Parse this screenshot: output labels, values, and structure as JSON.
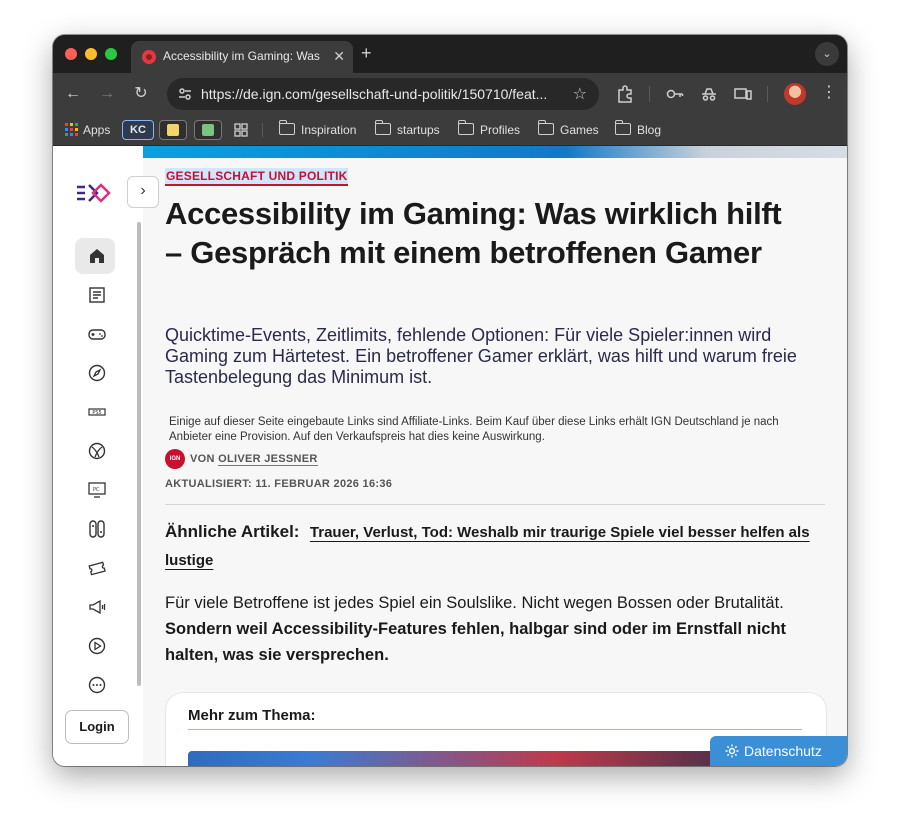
{
  "browser": {
    "tab_title": "Accessibility im Gaming: Was wirklich hilft – Gespräch mit einem betroffenen Gamer",
    "tab_close": "✕",
    "new_tab": "+",
    "url": "https://de.ign.com/gesellschaft-und-politik/150710/feat...",
    "bookmarks": {
      "apps": "Apps",
      "kc": "KC",
      "folders": [
        "Inspiration",
        "startups",
        "Profiles",
        "Games",
        "Blog"
      ]
    }
  },
  "sidebar": {
    "login": "Login",
    "icons": [
      "home-icon",
      "news-icon",
      "gamepad-icon",
      "compass-icon",
      "ps5-icon",
      "xbox-icon",
      "pc-icon",
      "switch-icon",
      "ticket-icon",
      "megaphone-icon",
      "play-icon",
      "more-icon"
    ]
  },
  "article": {
    "kicker": "GESELLSCHAFT UND POLITIK",
    "headline": "Accessibility im Gaming: Was wirklich hilft – Gespräch mit einem betroffenen Gamer",
    "deck": "Quicktime-Events, Zeitlimits, fehlende Optionen: Für viele Spieler:innen wird Gaming zum Härtetest. Ein betroffener Gamer erklärt, was hilft und warum freie Tastenbelegung das Minimum ist.",
    "disclaimer": "Einige auf dieser Seite eingebaute Links sind Affiliate-Links. Beim Kauf über diese Links erhält IGN Deutschland je nach Anbieter eine Provision. Auf den Verkaufspreis hat dies keine Auswirkung.",
    "author_logo": "IGN",
    "byline_prefix": "VON",
    "author": "OLIVER JESSNER",
    "updated": "AKTUALISIERT: 11. FEBRUAR 2026 16:36",
    "related_label": "Ähnliche Artikel:",
    "related_link": "Trauer, Verlust, Tod: Weshalb mir traurige Spiele viel besser helfen als lustige",
    "body_plain": "Für viele Betroffene ist jedes Spiel ein Soulslike. Nicht wegen Bossen oder Brutalität. ",
    "body_bold": "Sondern weil Accessibility-Features fehlen, halbgar sind oder im Ernstfall nicht halten, was sie versprechen.",
    "more_title": "Mehr zum Thema:"
  },
  "privacy": {
    "label": "Datenschutz"
  },
  "colors": {
    "accent_red": "#c41230",
    "privacy_blue": "#3b8fd6",
    "kicker_highlight": "#cfe6fb"
  }
}
